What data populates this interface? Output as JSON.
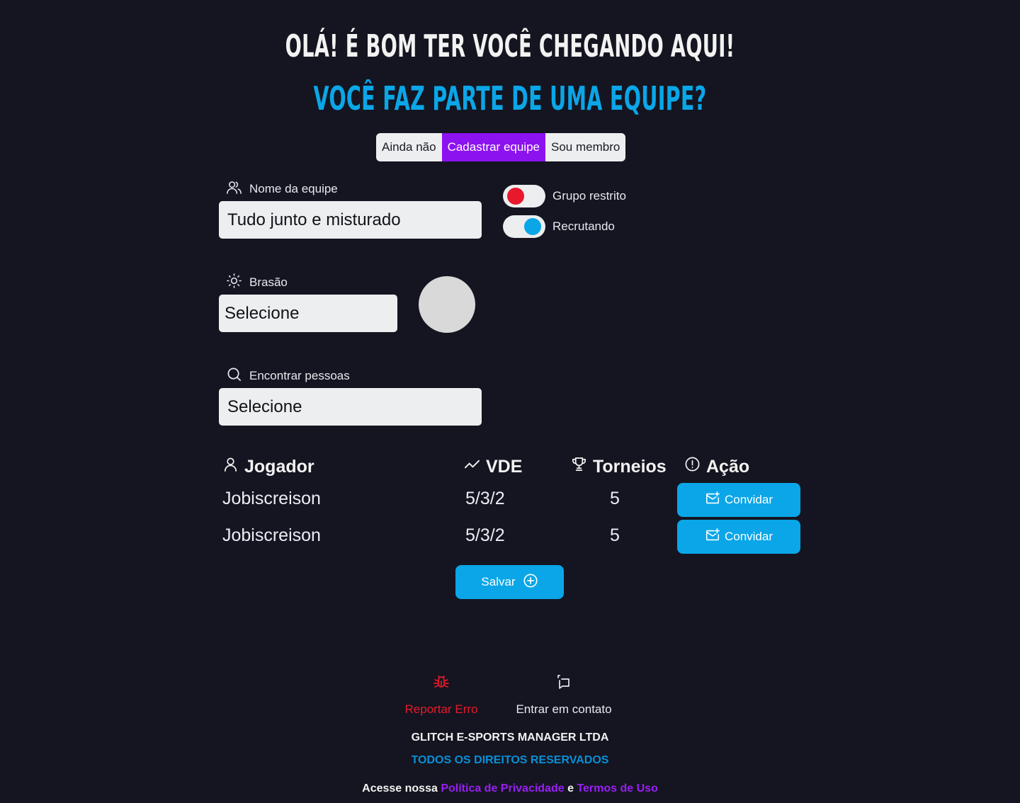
{
  "header": {
    "greeting": "OLÁ! É BOM TER VOCÊ CHEGANDO AQUI!",
    "question": "VOCÊ FAZ PARTE DE UMA EQUIPE?"
  },
  "team_options": {
    "items": [
      "Ainda não",
      "Cadastrar equipe",
      "Sou membro"
    ],
    "selected": "Cadastrar equipe"
  },
  "form": {
    "team_name": {
      "label": "Nome da equipe",
      "value": "Tudo junto e misturado",
      "icon": "users-icon"
    },
    "crest": {
      "label": "Brasão",
      "value": "Selecione",
      "icon": "sun-icon"
    },
    "find_people": {
      "label": "Encontrar pessoas",
      "value": "Selecione",
      "icon": "search-icon"
    },
    "restricted_group": {
      "label": "Grupo restrito",
      "knob_color": "#e8192c",
      "on": false
    },
    "recruiting": {
      "label": "Recrutando",
      "knob_color": "#0aa6e8",
      "on": true
    }
  },
  "players_table": {
    "headers": {
      "player": "Jogador",
      "vde": "VDE",
      "tournaments": "Torneios",
      "action": "Ação"
    },
    "rows": [
      {
        "player": "Jobiscreison",
        "vde": "5/3/2",
        "tournaments": "5",
        "action_label": "Convidar"
      },
      {
        "player": "Jobiscreison",
        "vde": "5/3/2",
        "tournaments": "5",
        "action_label": "Convidar"
      }
    ]
  },
  "save_button": {
    "label": "Salvar"
  },
  "footer": {
    "report_error": "Reportar Erro",
    "contact": "Entrar em contato",
    "company": "GLITCH E-SPORTS MANAGER LTDA",
    "rights": "TODOS OS DIREITOS RESERVADOS",
    "access_prefix": "Acesse nossa",
    "privacy_policy": "Política de Privacidade",
    "and": "e",
    "terms_of_use": "Termos de Uso"
  },
  "colors": {
    "background": "#141520",
    "accent_blue": "#0aa6e8",
    "accent_purple": "#8d12f0",
    "error_red": "#e8192c"
  }
}
